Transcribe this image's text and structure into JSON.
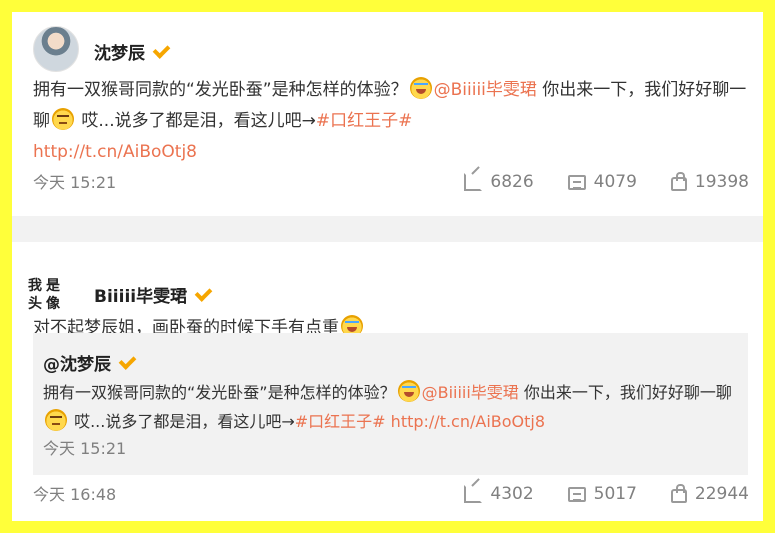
{
  "post1": {
    "author": "沈梦辰",
    "text_part1": "拥有一双猴哥同款的“发光卧蚕”是种怎样的体验？",
    "mention": "@Biiiii毕雯珺",
    "text_part2": " 你出来一下，我们好好聊一聊",
    "text_part3": " 哎...说多了都是泪，看这儿吧→",
    "hashtag": "#口红王子#",
    "url": "http://t.cn/AiBoOtj8",
    "time": "今天 15:21",
    "reposts": "6826",
    "comments": "4079",
    "likes": "19398"
  },
  "post2": {
    "avatar_text": [
      "我",
      "是",
      "头",
      "像"
    ],
    "author": "Biiiii毕雯珺",
    "text": "对不起梦辰姐，画卧蚕的时候下手有点重",
    "time": "今天 16:48",
    "reposts": "4302",
    "comments": "5017",
    "likes": "22944"
  },
  "quoted": {
    "author": "@沈梦辰",
    "text_part1": "拥有一双猴哥同款的“发光卧蚕”是种怎样的体验？",
    "mention": "@Biiiii毕雯珺",
    "text_part2": " 你出来一下，我们好好聊一聊",
    "text_part3": " 哎...说多了都是泪，看这儿吧→",
    "hashtag": "#口红王子#",
    "url": " http://t.cn/AiBoOtj8",
    "time": "今天 15:21"
  },
  "icons": {
    "repost": "share-icon",
    "comment": "comment-icon",
    "like": "thumbs-up-icon",
    "verified": "verified-v-icon",
    "emoji_laugh": "laugh-cry-emoji-icon",
    "emoji_think": "hmm-emoji-icon"
  },
  "colors": {
    "border": "#ffff3a",
    "link": "#eb7350",
    "verified": "#f6a600"
  }
}
